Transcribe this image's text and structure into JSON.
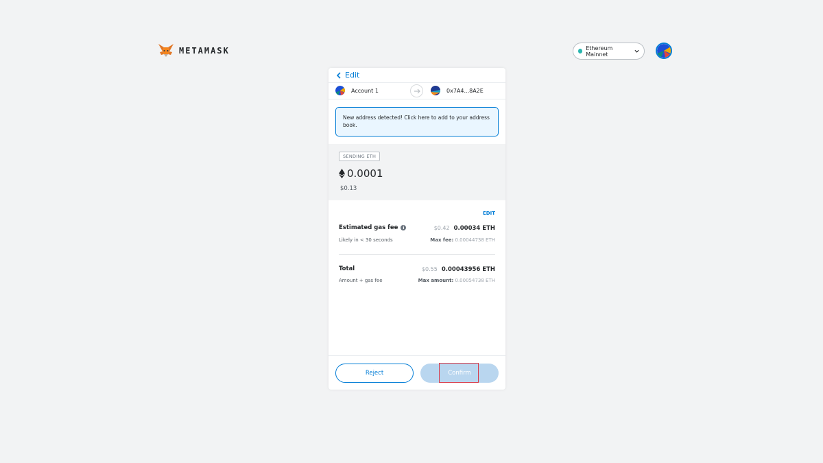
{
  "header": {
    "brand": "METAMASK",
    "network": "Ethereum Mainnet",
    "colors": {
      "brand_text": "#24272a",
      "network_dot": "#29b6af",
      "accent": "#037dd6"
    }
  },
  "card": {
    "back_label": "Edit",
    "from_account": "Account 1",
    "to_account": "0x7A4...8A2E",
    "alert_text": "New address detected! Click here to add to your address book.",
    "sending_badge": "SENDING ETH",
    "amount": "0.0001",
    "fiat_amount": "$0.13",
    "edit_gas_link": "EDIT",
    "gas": {
      "label": "Estimated gas fee",
      "usd": "$0.42",
      "eth": "0.00034 ETH",
      "sub": "Likely in < 30 seconds",
      "max_label": "Max fee:",
      "max_value": "0.00044738 ETH"
    },
    "total": {
      "label": "Total",
      "usd": "$0.55",
      "eth": "0.00043956 ETH",
      "sub": "Amount + gas fee",
      "max_label": "Max amount:",
      "max_value": "0.00054738 ETH"
    },
    "reject_label": "Reject",
    "confirm_label": "Confirm"
  },
  "icons": [
    "fox-logo-icon",
    "chevron-down-icon",
    "chevron-left-icon",
    "arrow-right-icon",
    "ethereum-icon",
    "info-icon"
  ]
}
